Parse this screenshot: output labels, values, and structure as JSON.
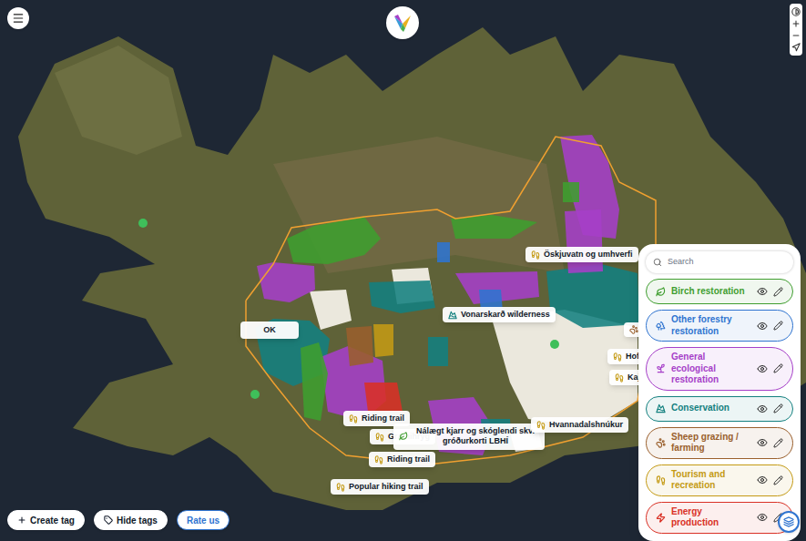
{
  "map": {
    "tags": [
      {
        "label": "Öskjuvatn og umhverfi",
        "category": "Tourism and recreation"
      },
      {
        "label": "Vonarskarð wilderness",
        "category": "Conservation"
      },
      {
        "label": "OK",
        "category": ""
      },
      {
        "label": "",
        "category": "Sheep grazing / farming"
      },
      {
        "label": "Hoff",
        "category": "Tourism and recreation"
      },
      {
        "label": "Kaja",
        "category": "Tourism and recreation"
      },
      {
        "label": "Riding trail",
        "category": "Tourism and recreation"
      },
      {
        "label": "Grænihryg",
        "category": "Tourism and recreation"
      },
      {
        "label": "Nálægt kjarr og skóglendi skv. gróðurkorti LBHÍ",
        "category": "Birch restoration"
      },
      {
        "label": "Hvannadalshnúkur",
        "category": "Tourism and recreation"
      },
      {
        "label": "Riding trail",
        "category": "Tourism and recreation"
      },
      {
        "label": "Popular hiking trail",
        "category": "Tourism and recreation"
      }
    ]
  },
  "legend": {
    "search": {
      "placeholder": "Search"
    },
    "categories": [
      {
        "label": "Birch restoration",
        "color": "#3f9e2f",
        "visible": true
      },
      {
        "label": "Other forestry restoration",
        "color": "#2f74d0",
        "visible": true
      },
      {
        "label": "General ecological restoration",
        "color": "#a63fc8",
        "visible": true
      },
      {
        "label": "Conservation",
        "color": "#13807f",
        "visible": true
      },
      {
        "label": "Sheep grazing / farming",
        "color": "#9a5f2c",
        "visible": true
      },
      {
        "label": "Tourism and recreation",
        "color": "#c49a14",
        "visible": true
      },
      {
        "label": "Energy production",
        "color": "#d93025",
        "visible": true
      }
    ]
  },
  "toolbar": {
    "buttons": [
      {
        "label": "Create tag",
        "highlighted": false
      },
      {
        "label": "Hide tags",
        "highlighted": false
      },
      {
        "label": "Rate us",
        "highlighted": true
      }
    ]
  }
}
